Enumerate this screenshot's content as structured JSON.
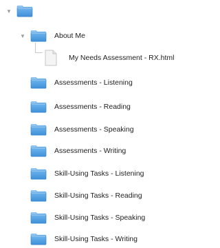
{
  "tree": {
    "root": {
      "expanded": true,
      "icon": "folder-icon"
    },
    "about_me": {
      "label": "About Me",
      "expanded": true,
      "icon": "folder-icon",
      "children": [
        {
          "label": "My Needs Assessment - RX.html",
          "icon": "html-file-icon"
        }
      ]
    },
    "folders": [
      {
        "label": "Assessments - Listening",
        "icon": "folder-icon"
      },
      {
        "label": "Assessments - Reading",
        "icon": "folder-icon"
      },
      {
        "label": "Assessments - Speaking",
        "icon": "folder-icon"
      },
      {
        "label": "Assessments - Writing",
        "icon": "folder-icon"
      },
      {
        "label": "Skill-Using Tasks - Listening",
        "icon": "folder-icon"
      },
      {
        "label": "Skill-Using Tasks - Reading",
        "icon": "folder-icon"
      },
      {
        "label": "Skill-Using Tasks - Speaking",
        "icon": "folder-icon"
      },
      {
        "label": "Skill-Using Tasks - Writing",
        "icon": "folder-icon"
      }
    ]
  },
  "colors": {
    "folder_front": "#4a9be0",
    "folder_back": "#8fc4f0",
    "folder_edge": "#2f7fc8",
    "disclosure": "#9a9a9a",
    "guide": "#c8c8c8",
    "text": "#222222"
  }
}
